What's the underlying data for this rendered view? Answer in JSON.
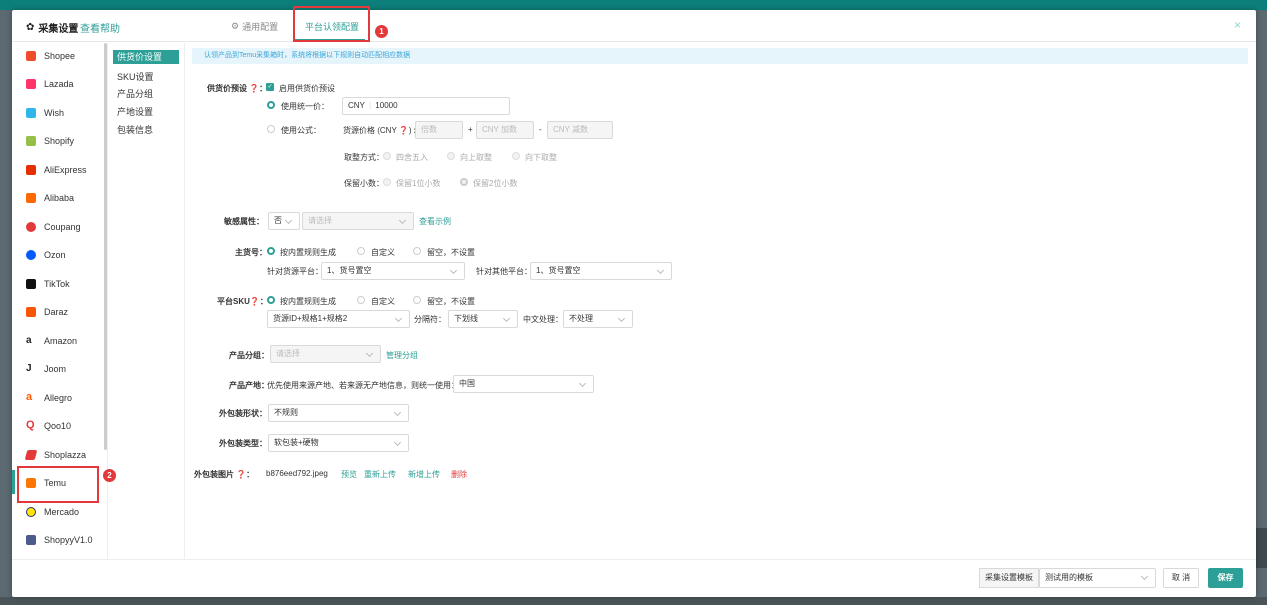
{
  "header": {
    "title": "采集设置",
    "help_link": "查看帮助",
    "tab_general": "通用配置",
    "tab_platform": "平台认领配置",
    "badge1": "1"
  },
  "platforms": [
    {
      "label": "Shopee",
      "color": "#ee4d2d"
    },
    {
      "label": "Lazada",
      "color": "#f36"
    },
    {
      "label": "Wish",
      "color": "#2fb7ec"
    },
    {
      "label": "Shopify",
      "color": "#95bf47"
    },
    {
      "label": "AliExpress",
      "color": "#e62e04"
    },
    {
      "label": "Alibaba",
      "color": "#ff6a00"
    },
    {
      "label": "Coupang",
      "color": "#e3393b"
    },
    {
      "label": "Ozon",
      "color": "#005bff"
    },
    {
      "label": "TikTok",
      "color": "#111"
    },
    {
      "label": "Daraz",
      "color": "#f85606"
    },
    {
      "label": "Amazon",
      "color": "#222"
    },
    {
      "label": "Joom",
      "color": "#222"
    },
    {
      "label": "Allegro",
      "color": "#ff5a00"
    },
    {
      "label": "Qoo10",
      "color": "#e3393b"
    },
    {
      "label": "Shoplazza",
      "color": "#e3393b"
    },
    {
      "label": "Temu",
      "color": "#fb7701"
    },
    {
      "label": "Mercado",
      "color": "#ffe600"
    },
    {
      "label": "ShopyyV1.0",
      "color": "#4a5b8c"
    }
  ],
  "badge2": "2",
  "subnav": [
    "供货价设置",
    "SKU设置",
    "产品分组",
    "产地设置",
    "包装信息"
  ],
  "info": "认领产品到Temu采集箱时，系统将根据以下规则自动匹配相应数据",
  "supply_price": {
    "label": "供货价预设 ❓：",
    "enable_label": "启用供货价预设",
    "unified_label": "使用统一价：",
    "currency": "CNY",
    "unified_value": "10000",
    "formula_label": "使用公式：",
    "formula_text": "货源价格 (CNY ❓) x",
    "ph_multiplier": "倍数",
    "plus": "+",
    "ph_add": "CNY 加数",
    "minus": "-",
    "ph_sub": "CNY 减数",
    "rounding_label": "取整方式：",
    "rounding_opts": [
      "四舍五入",
      "向上取整",
      "向下取整"
    ],
    "decimal_label": "保留小数：",
    "decimal_opts": [
      "保留1位小数",
      "保留2位小数"
    ]
  },
  "sensitive": {
    "label": "敏感属性：",
    "value": "否",
    "placeholder": "请选择",
    "link": "查看示例"
  },
  "main_sku": {
    "label": "主货号：",
    "opts": [
      "按内置规则生成",
      "自定义",
      "留空，不设置"
    ],
    "source_label": "针对货源平台：",
    "source_value": "1、货号置空",
    "other_label": "针对其他平台：",
    "other_value": "1、货号置空"
  },
  "platform_sku": {
    "label": "平台SKU❓：",
    "opts": [
      "按内置规则生成",
      "自定义",
      "留空，不设置"
    ],
    "rule_value": "货源ID+规格1+规格2",
    "sep_label": "分隔符：",
    "sep_value": "下划线",
    "cn_label": "中文处理：",
    "cn_value": "不处理"
  },
  "group": {
    "label": "产品分组：",
    "placeholder": "请选择",
    "link": "管理分组"
  },
  "origin": {
    "label": "产品产地：",
    "desc": "优先使用来源产地、若来源无产地信息，则统一使用：",
    "value": "中国"
  },
  "pkg_shape": {
    "label": "外包装形状：",
    "value": "不规则"
  },
  "pkg_type": {
    "label": "外包装类型：",
    "value": "软包装+硬物"
  },
  "pkg_image": {
    "label": "外包装图片 ❓：",
    "filename": "b876eed792.jpeg",
    "preview": "预览",
    "reupload": "重新上传",
    "add": "新增上传",
    "delete": "删除"
  },
  "footer": {
    "template_label": "采集设置模板",
    "template_value": "测试用的模板",
    "cancel": "取 消",
    "save": "保存"
  }
}
